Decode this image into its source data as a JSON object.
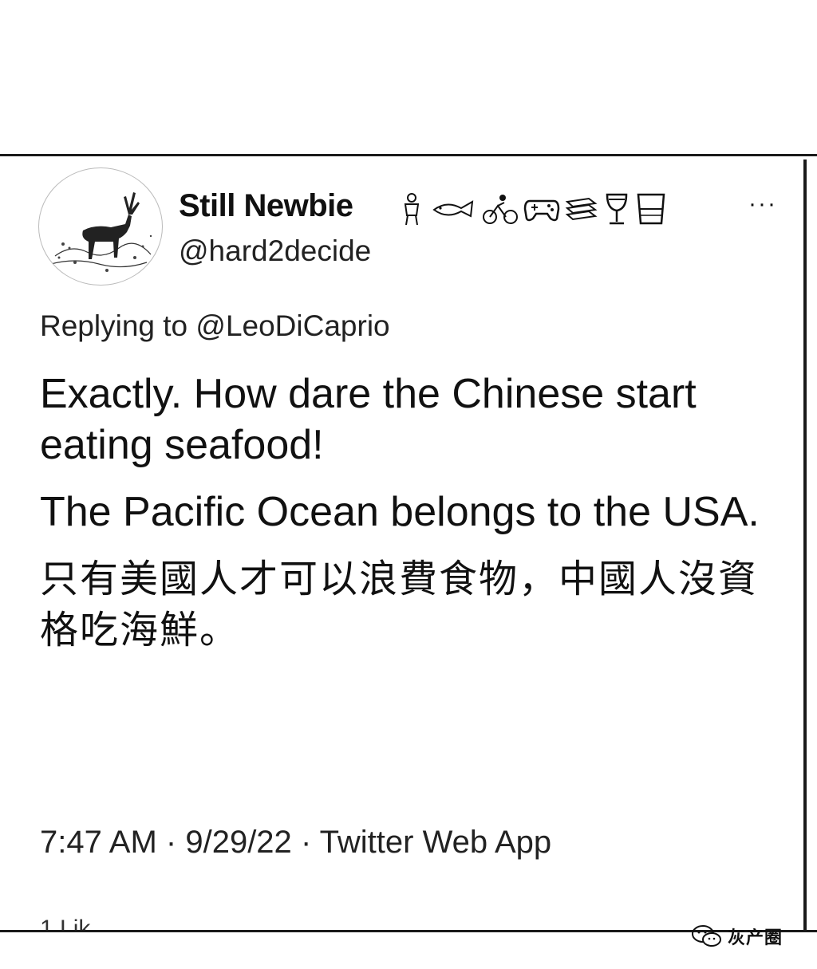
{
  "author": {
    "display_name": "Still Newbie",
    "handle": "@hard2decide",
    "name_emojis": [
      "person-pouting-icon",
      "fish-icon",
      "cyclist-icon",
      "game-controller-icon",
      "books-icon",
      "wine-glass-icon",
      "tumbler-glass-icon"
    ]
  },
  "reply_context": {
    "prefix": "Replying to",
    "mention": "@LeoDiCaprio"
  },
  "tweet": {
    "paragraphs": [
      "Exactly. How dare the Chinese start eating seafood!",
      "The Pacific Ocean belongs to the USA.",
      "只有美國人才可以浪費食物，中國人沒資格吃海鮮。"
    ]
  },
  "meta": {
    "time": "7:47 AM",
    "separator": "·",
    "date": "9/29/22",
    "source": "Twitter Web App"
  },
  "cut_off_text": "1 Lik",
  "watermark": {
    "text": "灰产圈",
    "icon": "wechat-icon"
  },
  "more_button": {
    "label": "···",
    "icon": "more-icon"
  }
}
